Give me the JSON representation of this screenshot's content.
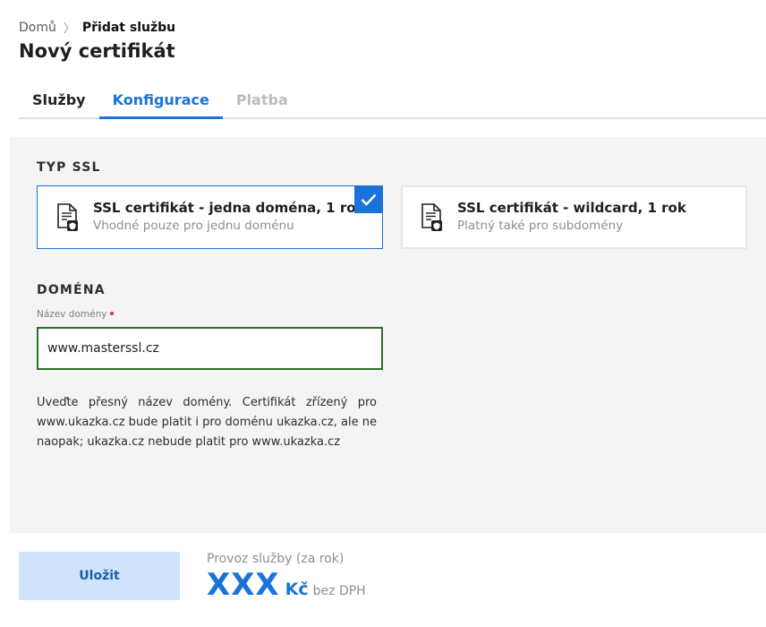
{
  "breadcrumb": {
    "home": "Domů",
    "separator": "〉",
    "current": "Přidat službu"
  },
  "page": {
    "title": "Nový certifikát"
  },
  "tabs": [
    {
      "label": "Služby",
      "state": "default"
    },
    {
      "label": "Konfigurace",
      "state": "active"
    },
    {
      "label": "Platba",
      "state": "disabled"
    }
  ],
  "ssl_section": {
    "title": "TYP SSL",
    "options": [
      {
        "title": "SSL certifikát - jedna doména, 1 rok",
        "subtitle": "Vhodné pouze pro jednu doménu",
        "selected": true,
        "icon": "certificate-icon"
      },
      {
        "title": "SSL certifikát - wildcard, 1 rok",
        "subtitle": "Platný také pro subdomény",
        "selected": false,
        "icon": "certificate-icon"
      }
    ]
  },
  "domain_section": {
    "title": "DOMÉNA",
    "field_label": "Název domény",
    "value": "www.masterssl.cz",
    "help": "Uveďte přesný název domény. Certifikát zřízený pro www.ukazka.cz bude platit i pro doménu ukazka.cz, ale ne naopak; ukazka.cz nebude platit pro www.ukazka.cz"
  },
  "footer": {
    "save_label": "Uložit",
    "price_label": "Provoz služby (za rok)",
    "price_value": "XXX",
    "currency": "Kč",
    "vat_note": "bez DPH"
  },
  "colors": {
    "accent": "#1a73d9",
    "input_border": "#2f6f2b",
    "panel_bg": "#f4f4f4",
    "required": "#e0245e"
  }
}
